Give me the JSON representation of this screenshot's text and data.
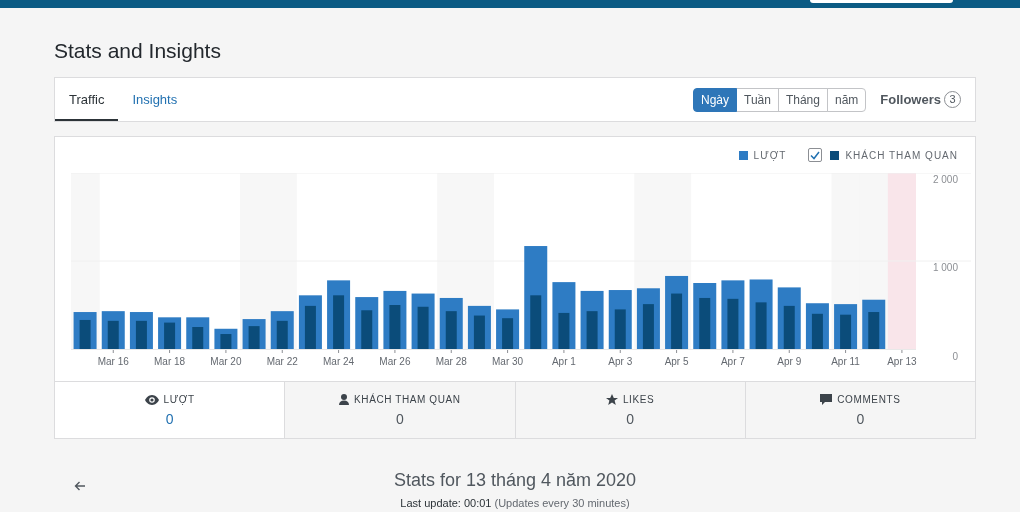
{
  "page_title": "Stats and Insights",
  "tabs": [
    {
      "label": "Traffic",
      "selected": true
    },
    {
      "label": "Insights",
      "selected": false
    }
  ],
  "periods": [
    {
      "label": "Ngày",
      "selected": true
    },
    {
      "label": "Tuần",
      "selected": false
    },
    {
      "label": "Tháng",
      "selected": false
    },
    {
      "label": "năm",
      "selected": false
    }
  ],
  "followers": {
    "label": "Followers",
    "count": "3"
  },
  "chart": {
    "legend_checkbox": {
      "checked": true
    },
    "days": [
      {
        "weekend": true,
        "selected": false
      },
      {
        "weekend": false,
        "selected": false
      },
      {
        "weekend": false,
        "selected": false
      },
      {
        "weekend": false,
        "selected": false
      },
      {
        "weekend": false,
        "selected": false
      },
      {
        "weekend": false,
        "selected": false
      },
      {
        "weekend": true,
        "selected": false
      },
      {
        "weekend": true,
        "selected": false
      },
      {
        "weekend": false,
        "selected": false
      },
      {
        "weekend": false,
        "selected": false
      },
      {
        "weekend": false,
        "selected": false
      },
      {
        "weekend": false,
        "selected": false
      },
      {
        "weekend": false,
        "selected": false
      },
      {
        "weekend": true,
        "selected": false
      },
      {
        "weekend": true,
        "selected": false
      },
      {
        "weekend": false,
        "selected": false
      },
      {
        "weekend": false,
        "selected": false
      },
      {
        "weekend": false,
        "selected": false
      },
      {
        "weekend": false,
        "selected": false
      },
      {
        "weekend": false,
        "selected": false
      },
      {
        "weekend": true,
        "selected": false
      },
      {
        "weekend": true,
        "selected": false
      },
      {
        "weekend": false,
        "selected": false
      },
      {
        "weekend": false,
        "selected": false
      },
      {
        "weekend": false,
        "selected": false
      },
      {
        "weekend": false,
        "selected": false
      },
      {
        "weekend": false,
        "selected": false
      },
      {
        "weekend": true,
        "selected": false
      },
      {
        "weekend": true,
        "selected": false
      },
      {
        "weekend": false,
        "selected": true
      }
    ],
    "chart_data": {
      "type": "bar",
      "categories": [
        null,
        "Mar 16",
        null,
        "Mar 18",
        null,
        "Mar 20",
        null,
        "Mar 22",
        null,
        "Mar 24",
        null,
        "Mar 26",
        null,
        "Mar 28",
        null,
        "Mar 30",
        null,
        "Apr 1",
        null,
        "Apr 3",
        null,
        "Apr 5",
        null,
        "Apr 7",
        null,
        "Apr 9",
        null,
        "Apr 11",
        null,
        "Apr 13"
      ],
      "series": [
        {
          "name": "LƯỢT",
          "color": "#2e7cc4",
          "values": [
            420,
            430,
            420,
            360,
            360,
            230,
            340,
            430,
            610,
            780,
            590,
            660,
            630,
            580,
            490,
            450,
            1170,
            760,
            660,
            670,
            690,
            830,
            750,
            780,
            790,
            700,
            520,
            510,
            560,
            null
          ]
        },
        {
          "name": "KHÁCH THAM QUAN",
          "color": "#0b4c7a",
          "values": [
            330,
            320,
            320,
            300,
            250,
            170,
            260,
            320,
            490,
            610,
            440,
            500,
            480,
            430,
            380,
            350,
            610,
            410,
            430,
            450,
            510,
            630,
            580,
            570,
            530,
            490,
            400,
            390,
            420,
            null
          ]
        }
      ],
      "ylim": [
        0,
        2000
      ],
      "yticks": [
        {
          "value": 0,
          "label": "0"
        },
        {
          "value": 1000,
          "label": "1 000"
        },
        {
          "value": 2000,
          "label": "2 000"
        }
      ]
    }
  },
  "stat_tabs": [
    {
      "label": "LƯỢT",
      "value": "0",
      "selected": true
    },
    {
      "label": "KHÁCH THAM QUAN",
      "value": "0",
      "selected": false
    },
    {
      "label": "LIKES",
      "value": "0",
      "selected": false
    },
    {
      "label": "COMMENTS",
      "value": "0",
      "selected": false
    }
  ],
  "stats_heading": "Stats for 13 tháng 4 năm 2020",
  "last_update": {
    "time": "Last update: 00:01",
    "note": "(Updates every 30 minutes)"
  }
}
